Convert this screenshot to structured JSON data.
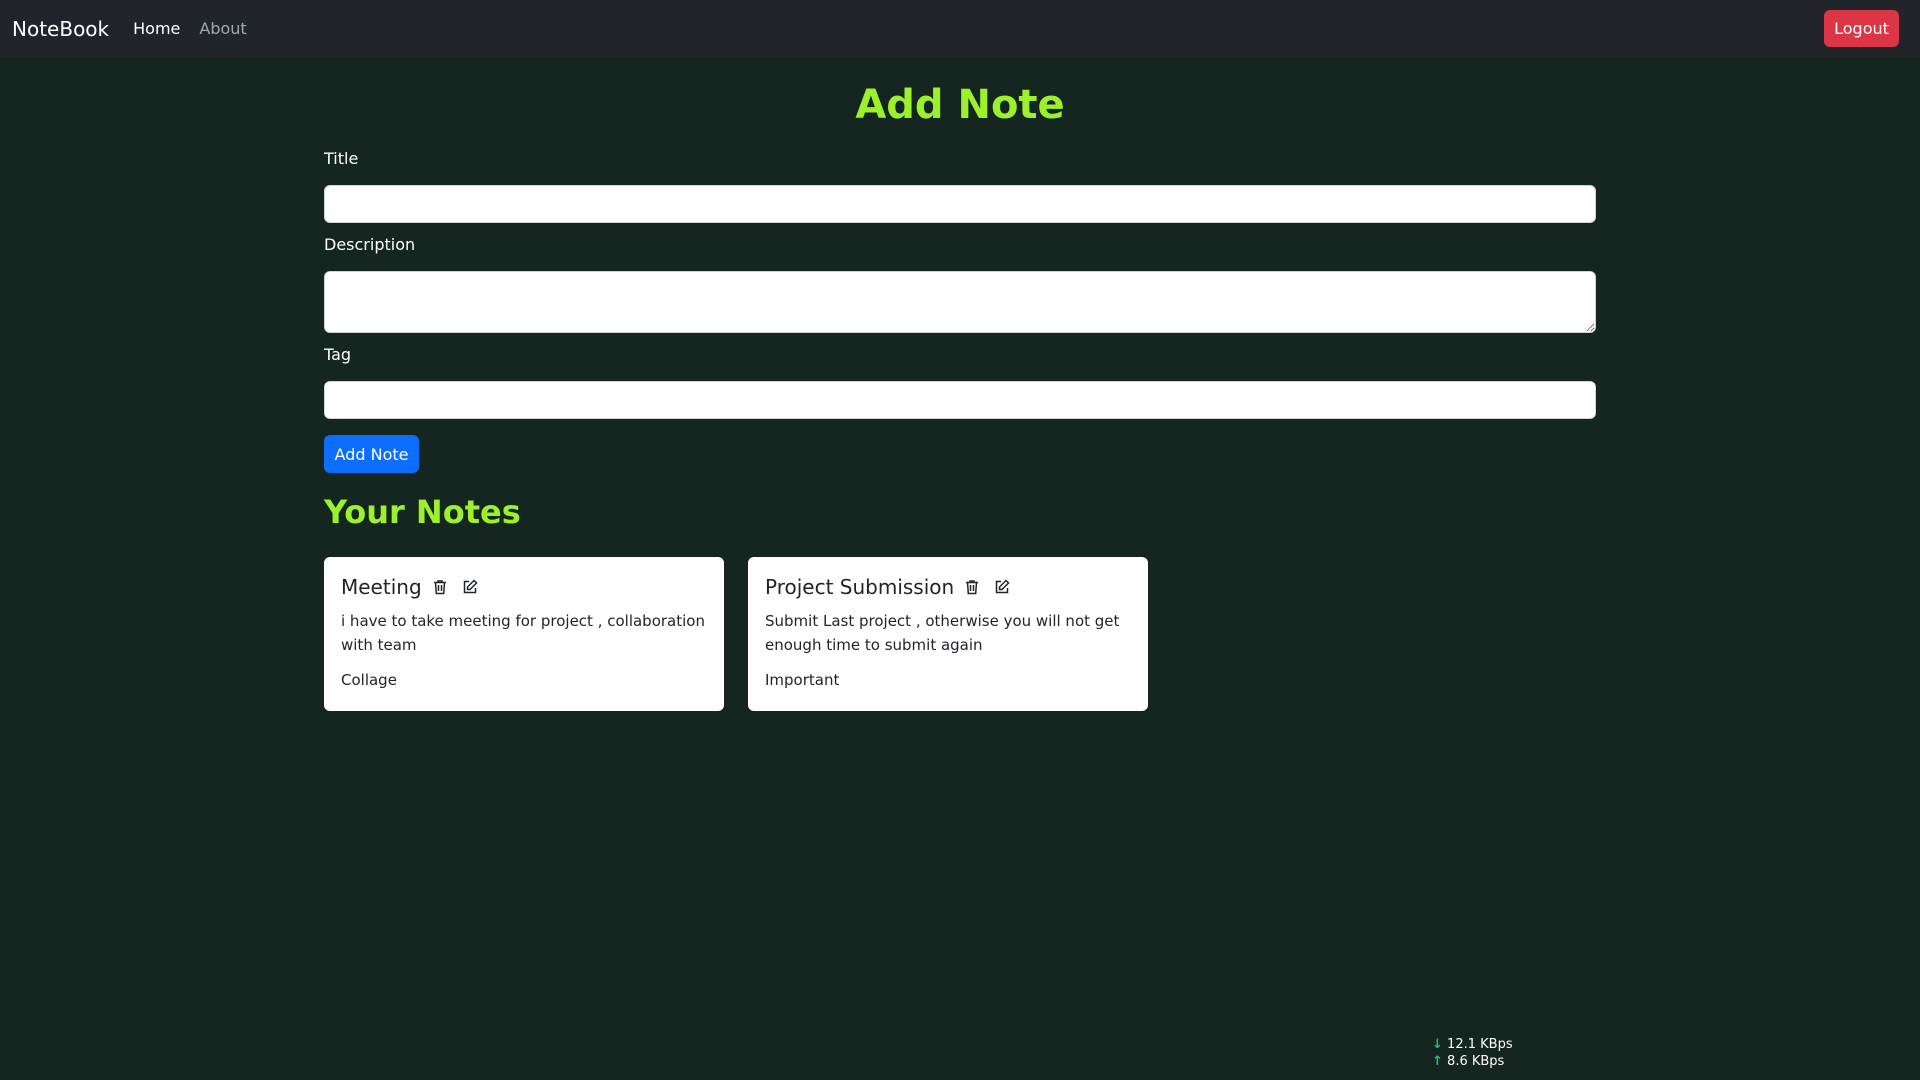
{
  "navbar": {
    "brand": "NoteBook",
    "links": [
      {
        "label": "Home"
      },
      {
        "label": "About"
      }
    ],
    "logout_label": "Logout"
  },
  "form": {
    "heading": "Add Note",
    "title_label": "Title",
    "title_value": "",
    "description_label": "Description",
    "description_value": "",
    "tag_label": "Tag",
    "tag_value": "",
    "submit_label": "Add Note"
  },
  "notes_section": {
    "heading": "Your Notes",
    "notes": [
      {
        "title": "Meeting",
        "description": "i have to take meeting for project , collaboration with team",
        "tag": "Collage"
      },
      {
        "title": "Project Submission",
        "description": "Submit Last project , otherwise you will not get enough time to submit again",
        "tag": "Important"
      }
    ]
  },
  "net_speed": {
    "download": "12.1 KBps",
    "upload": "8.6 KBps"
  },
  "icons": {
    "delete": "trash-icon",
    "edit": "edit-icon"
  },
  "colors": {
    "background": "#152620",
    "navbar": "#212529",
    "accent_green": "#9df02c",
    "primary_button": "#0d6efd",
    "danger_button": "#dc3545"
  }
}
